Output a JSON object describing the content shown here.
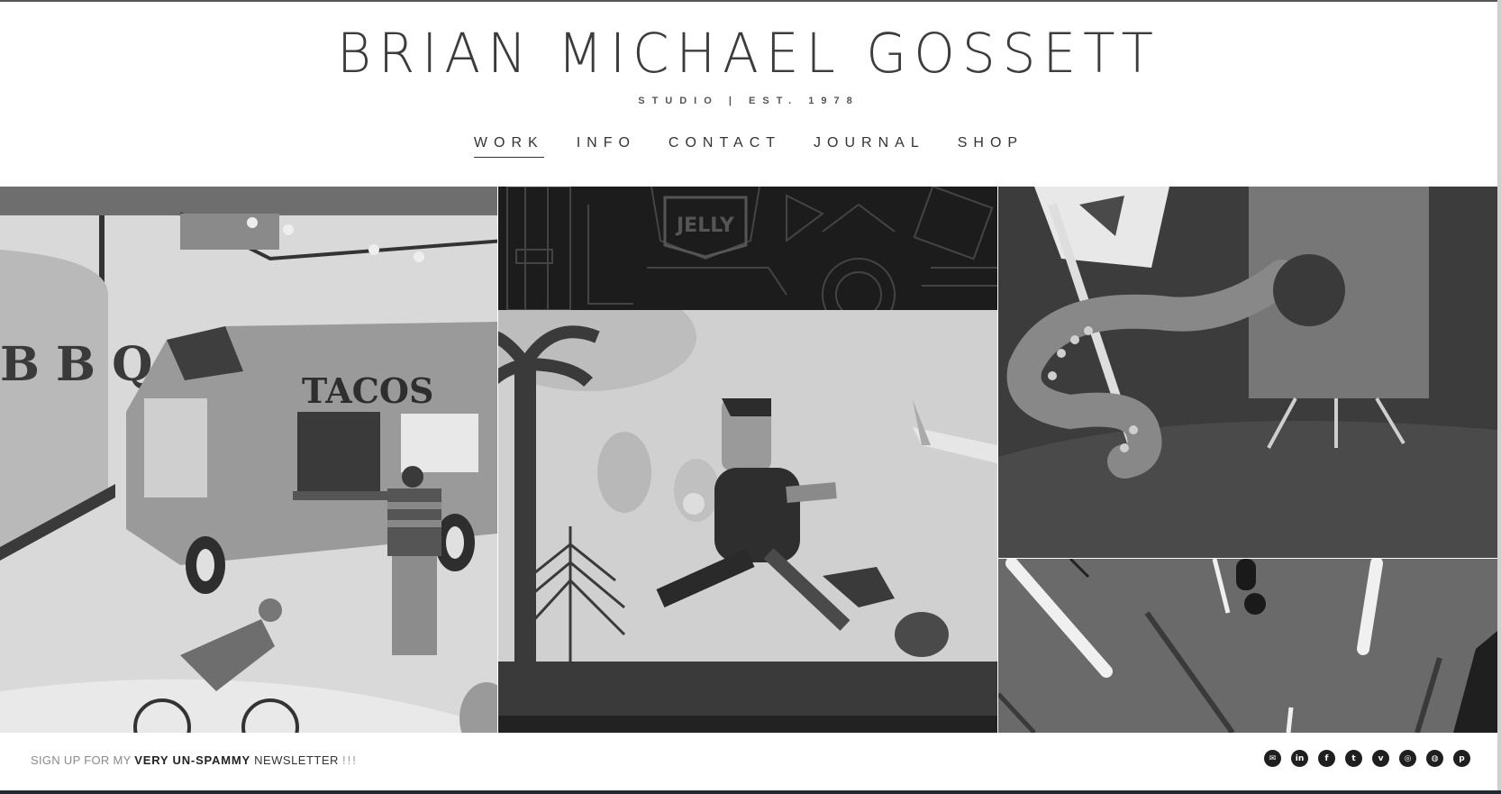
{
  "site": {
    "title": "BRIAN MICHAEL GOSSETT",
    "subtitle": "STUDIO | EST. 1978"
  },
  "nav": {
    "items": [
      {
        "label": "WORK",
        "active": true
      },
      {
        "label": "INFO",
        "active": false
      },
      {
        "label": "CONTACT",
        "active": false
      },
      {
        "label": "JOURNAL",
        "active": false
      },
      {
        "label": "SHOP",
        "active": false
      }
    ]
  },
  "tiles": {
    "bbq_word": "B B Q",
    "tacos_sign": "TACOS",
    "jelly_badge": "JELLY"
  },
  "footer": {
    "newsletter_pre": "SIGN UP FOR MY ",
    "newsletter_bold": "VERY UN-SPAMMY",
    "newsletter_post": " NEWSLETTER ",
    "newsletter_end": "!!!",
    "social": [
      {
        "icon": "mail-icon",
        "glyph": "✉"
      },
      {
        "icon": "linkedin-icon",
        "glyph": "in"
      },
      {
        "icon": "facebook-icon",
        "glyph": "f"
      },
      {
        "icon": "twitter-icon",
        "glyph": "t"
      },
      {
        "icon": "vimeo-icon",
        "glyph": "v"
      },
      {
        "icon": "instagram-icon",
        "glyph": "◎"
      },
      {
        "icon": "dribbble-icon",
        "glyph": "◍"
      },
      {
        "icon": "pinterest-icon",
        "glyph": "p"
      }
    ]
  },
  "colors": {
    "text": "#333333",
    "footer_edge": "#1f2a33"
  }
}
